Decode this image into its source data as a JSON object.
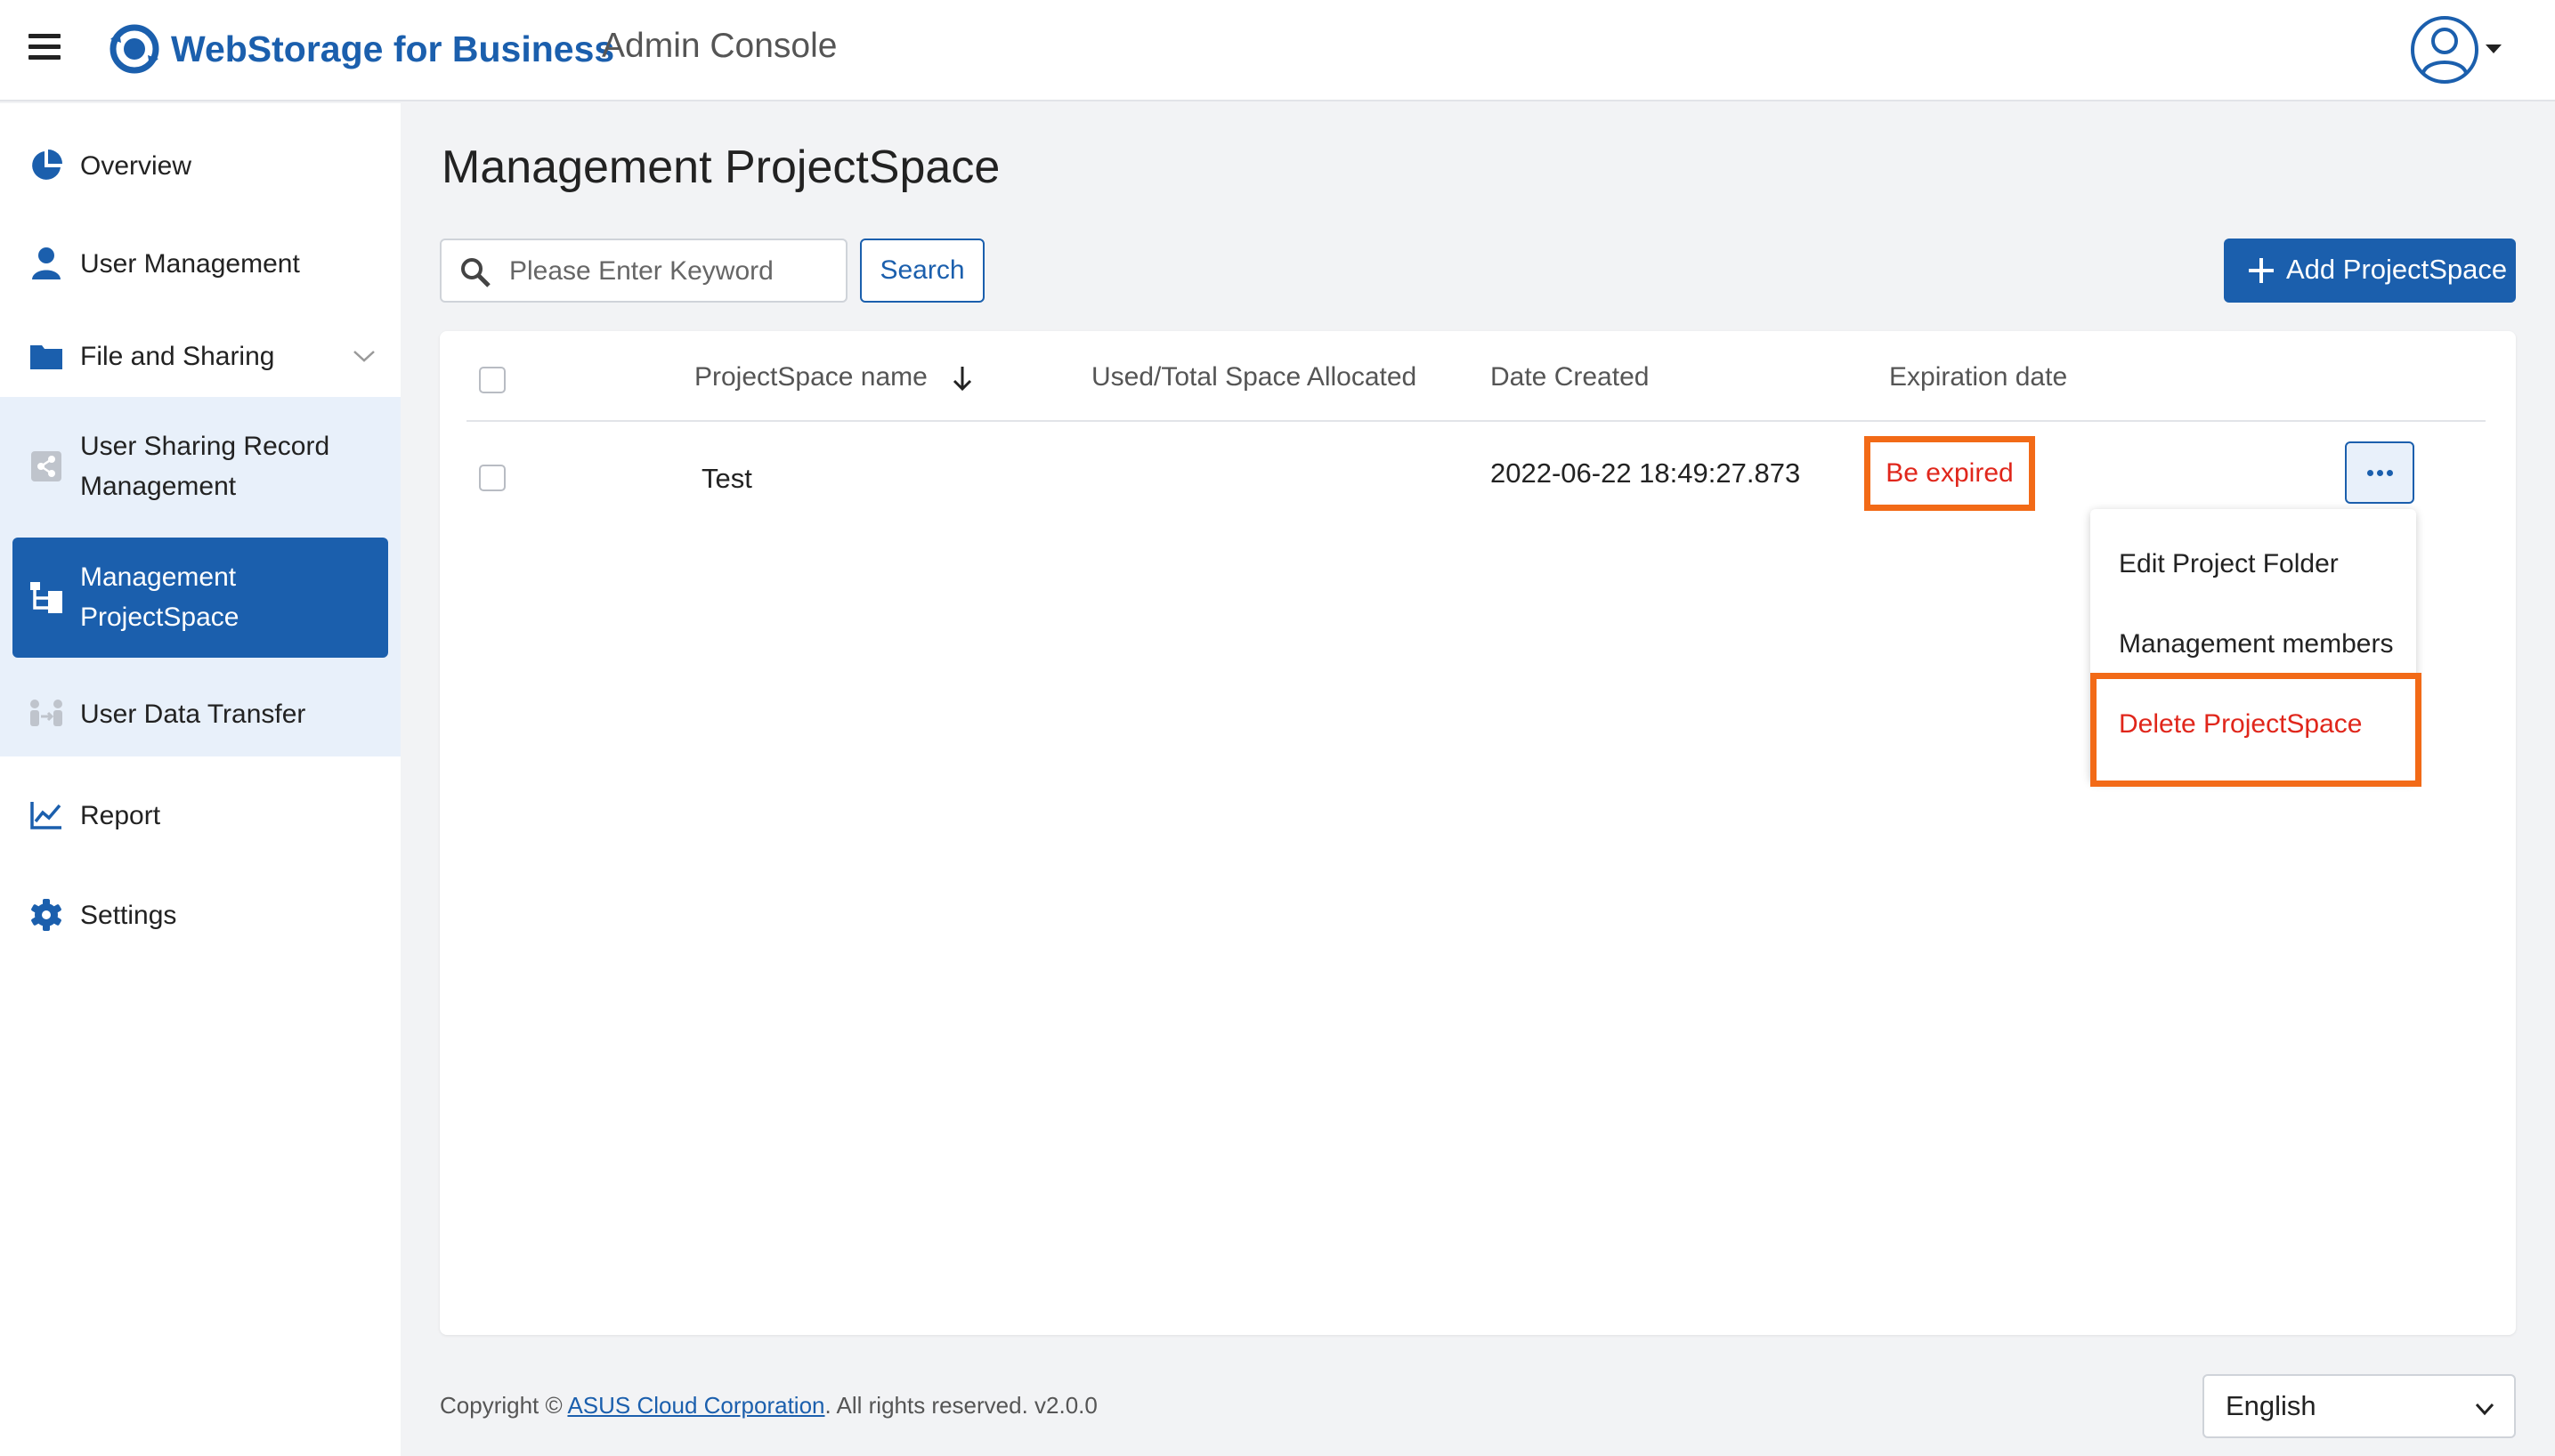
{
  "header": {
    "brand": "WebStorage for Business",
    "subtitle": "Admin Console",
    "brand_color": "#1b5fad"
  },
  "sidebar": {
    "items": [
      {
        "label": "Overview",
        "icon": "pie-chart-icon"
      },
      {
        "label": "User Management",
        "icon": "user-icon"
      },
      {
        "label": "File and Sharing",
        "icon": "folder-icon",
        "expanded": true
      },
      {
        "label": "User Sharing Record Management",
        "icon": "share-icon"
      },
      {
        "label": "Management ProjectSpace",
        "icon": "project-tree-icon",
        "active": true
      },
      {
        "label": "User Data Transfer",
        "icon": "transfer-icon"
      },
      {
        "label": "Report",
        "icon": "line-chart-icon"
      },
      {
        "label": "Settings",
        "icon": "gear-icon"
      }
    ]
  },
  "main": {
    "title": "Management ProjectSpace",
    "search": {
      "placeholder": "Please Enter Keyword",
      "value": "",
      "button_label": "Search"
    },
    "add_button_label": "Add ProjectSpace",
    "table": {
      "columns": [
        "ProjectSpace name",
        "Used/Total Space Allocated",
        "Date Created",
        "Expiration date"
      ],
      "sort_column": "ProjectSpace name",
      "rows": [
        {
          "name": "Test",
          "space": "",
          "date_created": "2022-06-22 18:49:27.873",
          "expiration": "Be expired"
        }
      ]
    },
    "row_menu": {
      "items": [
        "Edit Project Folder",
        "Management members",
        "Delete ProjectSpace"
      ],
      "highlighted": "Delete ProjectSpace"
    }
  },
  "footer": {
    "copyright_prefix": "Copyright ©",
    "company": "ASUS Cloud Corporation",
    "suffix": ". All rights reserved. v2.0.0",
    "language": "English"
  },
  "colors": {
    "accent": "#1b5fad",
    "danger": "#e0261b",
    "highlight": "#f26a17",
    "sub_bg": "#e8f0fa"
  }
}
